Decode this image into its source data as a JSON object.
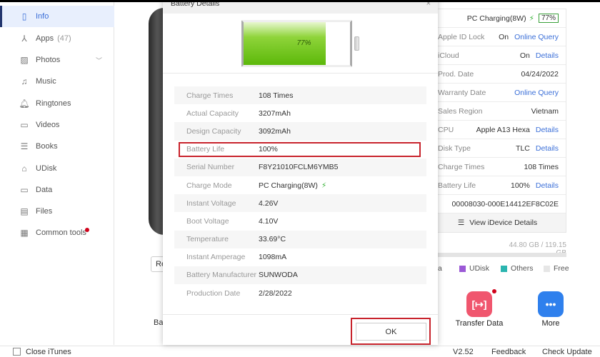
{
  "sidebar": {
    "items": [
      {
        "label": "Info",
        "icon": "tablet-icon"
      },
      {
        "label": "Apps",
        "count": "(47)",
        "icon": "apps-icon"
      },
      {
        "label": "Photos",
        "icon": "image-icon"
      },
      {
        "label": "Music",
        "icon": "music-icon"
      },
      {
        "label": "Ringtones",
        "icon": "bell-icon"
      },
      {
        "label": "Videos",
        "icon": "video-icon"
      },
      {
        "label": "Books",
        "icon": "book-icon"
      },
      {
        "label": "UDisk",
        "icon": "usb-icon"
      },
      {
        "label": "Data",
        "icon": "folder-icon"
      },
      {
        "label": "Files",
        "icon": "file-icon"
      },
      {
        "label": "Common tools",
        "icon": "grid-icon"
      }
    ]
  },
  "background": {
    "re_button": "Re",
    "ba_label": "Ba"
  },
  "device_info": {
    "charging": "PC Charging(8W)",
    "battery_badge": "77%",
    "rows": [
      {
        "label": "Apple ID Lock",
        "value": "On",
        "link": "Online Query"
      },
      {
        "label": "iCloud",
        "value": "On",
        "link": "Details"
      },
      {
        "label": "Prod. Date",
        "value": "04/24/2022"
      },
      {
        "label": "Warranty Date",
        "link": "Online Query"
      },
      {
        "label": "Sales Region",
        "value": "Vietnam"
      },
      {
        "label": "CPU",
        "value": "Apple A13 Hexa",
        "link": "Details"
      },
      {
        "label": "Disk Type",
        "value": "TLC",
        "link": "Details"
      },
      {
        "label": "Charge Times",
        "value": "108 Times"
      },
      {
        "label": "Battery Life",
        "value": "100%",
        "link": "Details"
      }
    ],
    "serial": "00008030-000E14412EF8C02E",
    "view_details": "View iDevice Details"
  },
  "storage": {
    "text": "44.80 GB / 119.15 GB",
    "legend": [
      {
        "label": "a",
        "color": "#f0a030"
      },
      {
        "label": "UDisk",
        "color": "#9b59d6"
      },
      {
        "label": "Others",
        "color": "#2bb5b0"
      },
      {
        "label": "Free",
        "color": "#e6e6e6"
      }
    ]
  },
  "tools": [
    {
      "label": "Transfer Data",
      "color": "#f0566e"
    },
    {
      "label": "More",
      "color": "#2f80ed"
    }
  ],
  "bottom": {
    "close_itunes": "Close iTunes",
    "version": "V2.52",
    "feedback": "Feedback",
    "check_update": "Check Update"
  },
  "dialog": {
    "title": "Battery Details",
    "close": "×",
    "battery_percent_label": "77%",
    "battery_level": 77,
    "rows": [
      {
        "label": "Charge Times",
        "value": "108 Times"
      },
      {
        "label": "Actual Capacity",
        "value": "3207mAh"
      },
      {
        "label": "Design Capacity",
        "value": "3092mAh"
      },
      {
        "label": "Battery Life",
        "value": "100%"
      },
      {
        "label": "Serial Number",
        "value": "F8Y21010FCLM6YMB5"
      },
      {
        "label": "Charge Mode",
        "value": "PC Charging(8W)"
      },
      {
        "label": "Instant Voltage",
        "value": "4.26V"
      },
      {
        "label": "Boot Voltage",
        "value": "4.10V"
      },
      {
        "label": "Temperature",
        "value": "33.69°C"
      },
      {
        "label": "Instant Amperage",
        "value": "1098mA"
      },
      {
        "label": "Battery Manufacturer",
        "value": "SUNWODA"
      },
      {
        "label": "Production Date",
        "value": "2/28/2022"
      }
    ],
    "ok": "OK"
  }
}
